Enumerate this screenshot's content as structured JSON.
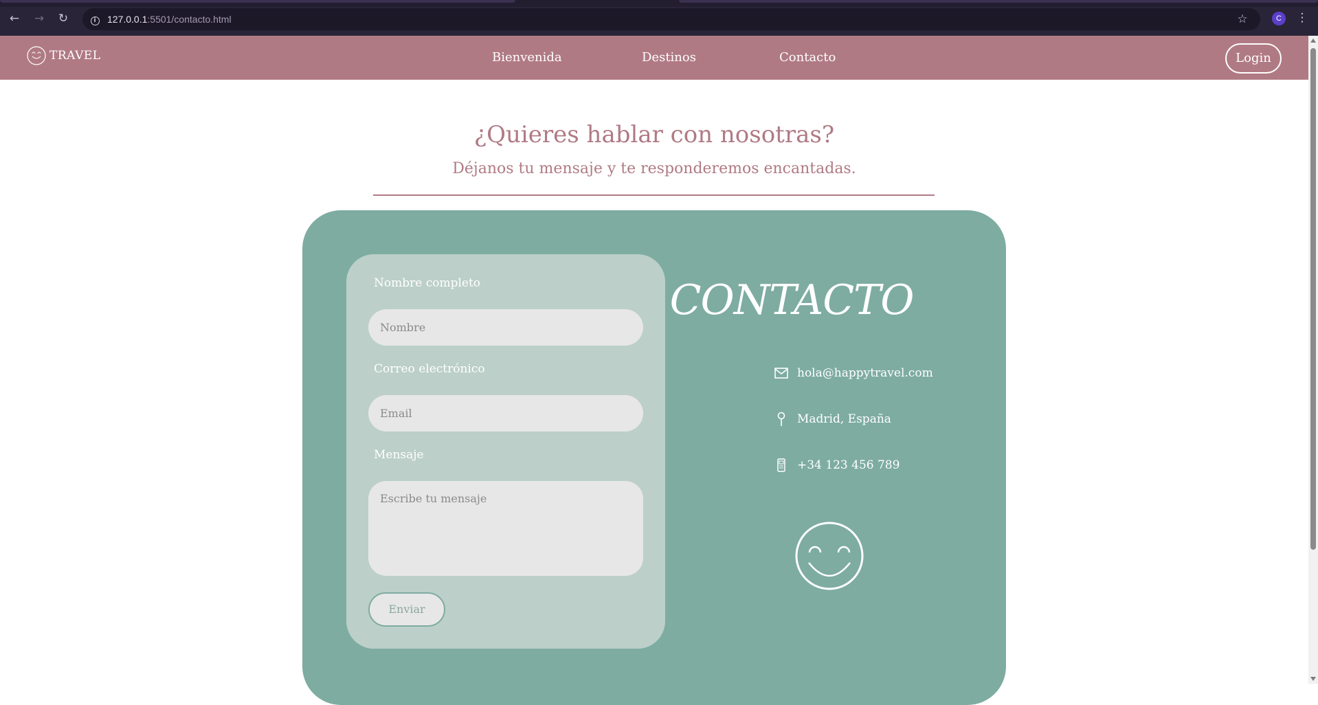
{
  "browser": {
    "url_host": "127.0.0.1",
    "url_path": ":5501/contacto.html",
    "profile_initial": "C",
    "icons": [
      "back-icon",
      "forward-icon",
      "reload-icon",
      "site-info-icon",
      "star-icon",
      "menu-dots-icon"
    ]
  },
  "header": {
    "logo_text": "TRAVEL",
    "nav": [
      "Bienvenida",
      "Destinos",
      "Contacto"
    ],
    "login_label": "Login",
    "background": "#b07a84"
  },
  "intro": {
    "title": "¿Quieres hablar con nosotras?",
    "subtitle": "Déjanos tu mensaje y te responderemos encantadas."
  },
  "form": {
    "name_label": "Nombre completo",
    "name_placeholder": "Nombre",
    "email_label": "Correo electrónico",
    "email_placeholder": "Email",
    "message_label": "Mensaje",
    "message_placeholder": "Escribe tu mensaje",
    "submit_label": "Enviar"
  },
  "contact": {
    "heading": "CONTACTO",
    "email": "hola@happytravel.com",
    "location": "Madrid, España",
    "phone": "+34 123 456 789",
    "icons": [
      "mail-icon",
      "location-pin-icon",
      "phone-icon",
      "smiley-icon"
    ],
    "card_color": "#7eaca1",
    "panel_color": "#bccfc9"
  }
}
